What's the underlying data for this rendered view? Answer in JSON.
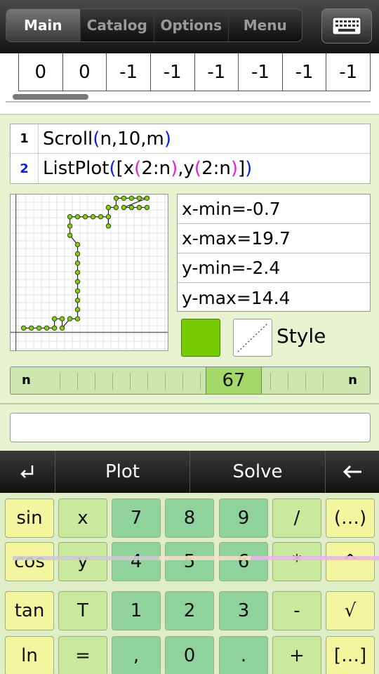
{
  "tabs": [
    "Main",
    "Catalog",
    "Options",
    "Menu"
  ],
  "keyboard_icon": "keyboard-icon",
  "list_values": [
    "0",
    "0",
    "-1",
    "-1",
    "-1",
    "-1",
    "-1",
    "-1"
  ],
  "commands": [
    {
      "num": "1",
      "fn": "Scroll",
      "open": "(",
      "args": "n,10,m",
      "close": ")"
    },
    {
      "num": "2",
      "fn": "ListPlot",
      "open1": "(",
      "open2": "[",
      "xfn": "x",
      "xarg": "2:n",
      "sep": ",",
      "yfn": "y",
      "yarg": "2:n",
      "close2": "]",
      "close1": ")"
    }
  ],
  "ranges": {
    "xmin": "x-min=-0.7",
    "xmax": "x-max=19.7",
    "ymin": "y-min=-2.4",
    "ymax": "y-max=14.4"
  },
  "plot": {
    "x_range": [
      -0.7,
      19.7
    ],
    "y_range": [
      -2.4,
      14.4
    ],
    "point_color": "#88cc22",
    "points": [
      [
        1,
        0
      ],
      [
        2,
        0
      ],
      [
        3,
        0
      ],
      [
        4,
        0
      ],
      [
        5,
        0
      ],
      [
        5,
        1
      ],
      [
        6,
        1
      ],
      [
        6,
        0
      ],
      [
        7,
        1
      ],
      [
        8,
        1
      ],
      [
        8,
        2
      ],
      [
        8,
        3
      ],
      [
        8,
        4
      ],
      [
        8,
        5
      ],
      [
        8,
        6
      ],
      [
        8,
        7
      ],
      [
        8,
        8
      ],
      [
        8,
        9
      ],
      [
        7,
        10
      ],
      [
        7,
        11
      ],
      [
        7,
        12
      ],
      [
        8,
        12
      ],
      [
        9,
        12
      ],
      [
        10,
        12
      ],
      [
        11,
        12
      ],
      [
        12,
        12
      ],
      [
        12,
        11
      ],
      [
        12,
        13
      ],
      [
        13,
        13
      ],
      [
        13,
        14
      ],
      [
        14,
        14
      ],
      [
        15,
        14
      ],
      [
        16,
        14
      ],
      [
        17,
        14
      ],
      [
        14,
        13
      ],
      [
        15,
        13
      ],
      [
        16,
        13
      ],
      [
        17,
        13
      ]
    ]
  },
  "series_color": "#77cc00",
  "style_label": "Style",
  "slider": {
    "left_label": "n",
    "right_label": "n",
    "value": "67"
  },
  "input_value": "",
  "actions": {
    "enter_icon": "return-icon",
    "plot": "Plot",
    "solve": "Solve",
    "back_icon": "arrow-left-icon"
  },
  "keys": [
    [
      "sin",
      "x",
      "7",
      "8",
      "9",
      "/",
      "(…)"
    ],
    [
      "cos",
      "y",
      "4",
      "5",
      "6",
      "*",
      "^"
    ],
    [
      "tan",
      "T",
      "1",
      "2",
      "3",
      "-",
      "√"
    ],
    [
      "ln",
      "=",
      ",",
      "0",
      ".",
      "+",
      "[…]"
    ]
  ]
}
